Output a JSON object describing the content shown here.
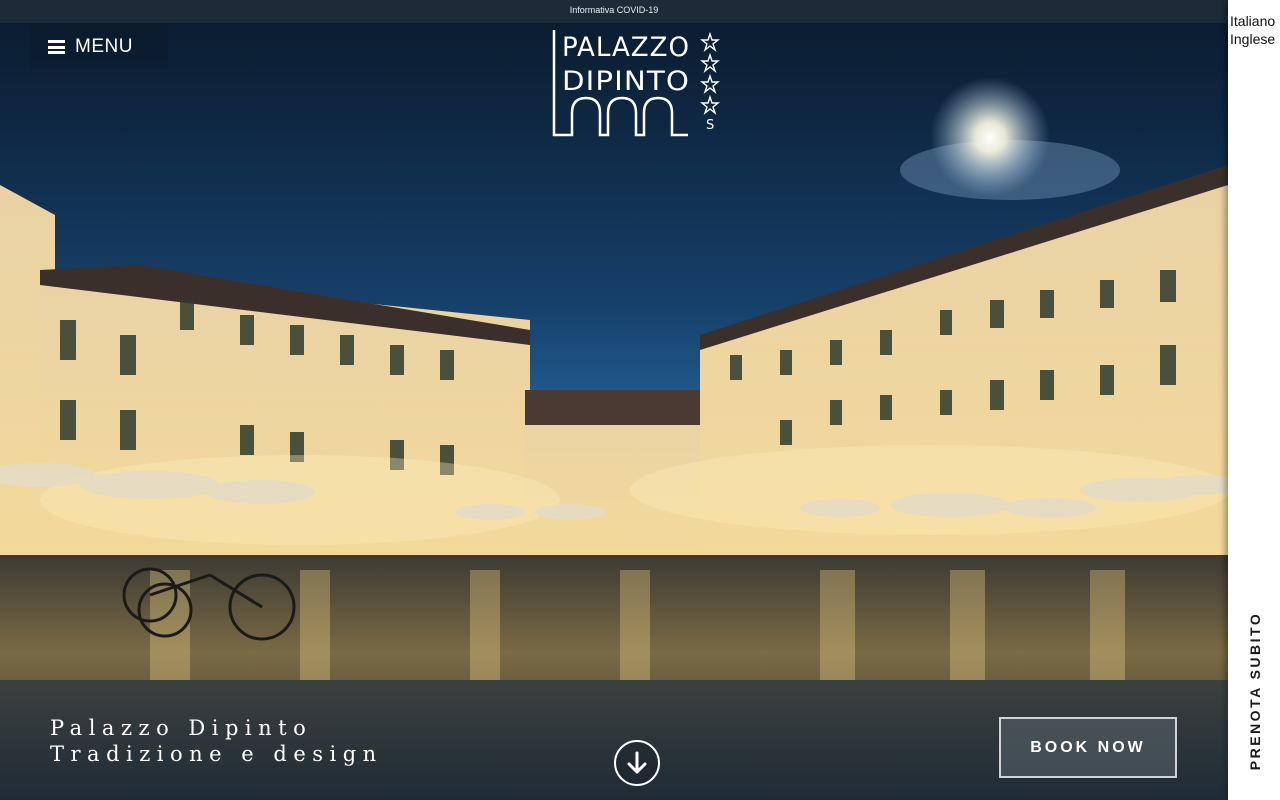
{
  "topbar": {
    "covid_link": "Informativa COVID-19"
  },
  "menu": {
    "label": "MENU",
    "icon": "hamburger-icon"
  },
  "logo": {
    "line1": "PALAZZO",
    "line2": "DIPINTO",
    "stars": 4,
    "superior": "S"
  },
  "languages": [
    {
      "label": "Italiano"
    },
    {
      "label": "Inglese"
    }
  ],
  "side_cta": {
    "label": "PRENOTA SUBITO"
  },
  "hero": {
    "tagline_line1": "Palazzo Dipinto",
    "tagline_line2": "Tradizione e design",
    "scroll_icon": "arrow-down-icon",
    "book_label": "BOOK NOW"
  },
  "colors": {
    "panel": "#ffffff",
    "topbar": "#1e2c38",
    "text_light": "#ffffff",
    "text_dark": "#111111"
  }
}
